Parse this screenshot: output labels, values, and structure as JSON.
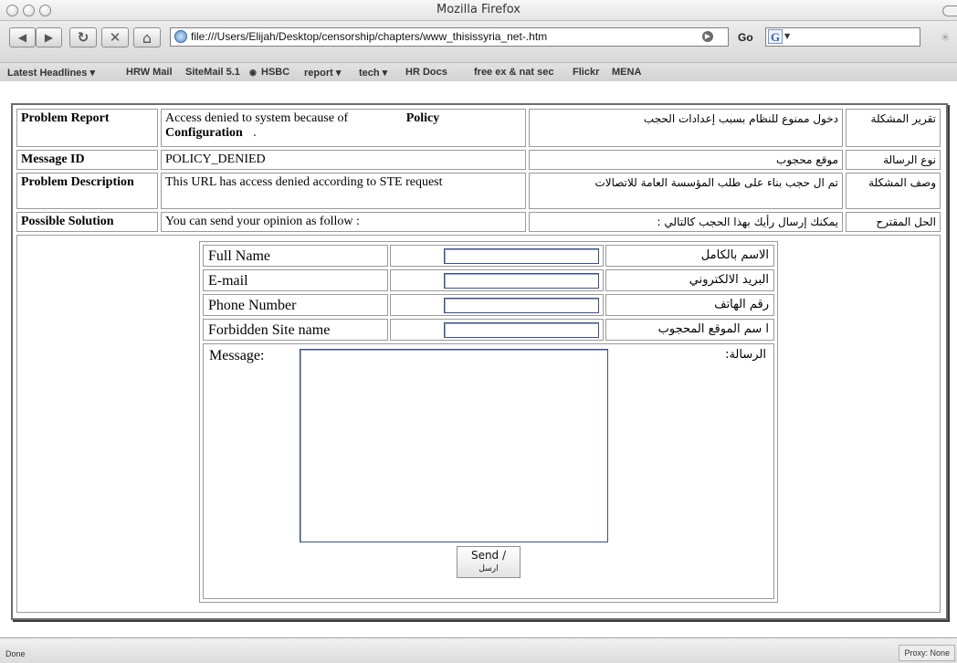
{
  "window": {
    "title": "Mozilla Firefox"
  },
  "nav": {
    "back_icon": "◀",
    "forward_icon": "▶",
    "reload_icon": "↻",
    "stop_icon": "✕",
    "home_icon": "⌂",
    "url": "file:///Users/Elijah/Desktop/censorship/chapters/www_thisissyria_net-.htm",
    "go_label": "Go",
    "search_engine_icon": "G"
  },
  "bookmarks": [
    "Latest Headlines ▾",
    "HRW Mail",
    "SiteMail 5.1",
    "HSBC",
    "report ▾",
    "tech ▾",
    "HR Docs",
    "free ex & nat sec",
    "Flickr",
    "MENA"
  ],
  "table": {
    "rows": [
      {
        "label": "Problem Report",
        "value": "Access denied to system because of",
        "value_bold": "Policy",
        "value_bold2": "Configuration",
        "value_end": ".",
        "ar_value": "دخول ممنوع للنظام بسبب إعدادات الحجب",
        "ar_label": "تقرير المشكلة"
      },
      {
        "label": "Message ID",
        "value": "POLICY_DENIED",
        "ar_value": "موقع محجوب",
        "ar_label": "نوع الرسالة"
      },
      {
        "label": "Problem Description",
        "value": "This URL has access denied according to STE request",
        "ar_value": "تم ال حجب بناء على طلب المؤسسة العامة للاتصالات",
        "ar_label": "وصف المشكلة"
      },
      {
        "label": "Possible Solution",
        "value": "You can send  your opinion as follow :",
        "ar_value": "يمكنك إرسال رأيك بهذا الحجب كالتالي :",
        "ar_label": "الحل المقترح"
      }
    ]
  },
  "form": {
    "fields": [
      {
        "label": "Full Name",
        "ar_label": "الاسم بالكامل",
        "value": ""
      },
      {
        "label": "E-mail",
        "ar_label": "البريد الالكتروني",
        "value": ""
      },
      {
        "label": "Phone Number",
        "ar_label": "رقم الهاتف",
        "value": ""
      },
      {
        "label": "Forbidden Site name",
        "ar_label": "ا سم الموقع المحجوب",
        "value": ""
      }
    ],
    "message_label": "Message:",
    "message_ar_label": "الرسالة:",
    "send_label": "Send /",
    "send_ar_label": "ارسل"
  },
  "status": {
    "text": "Done",
    "proxy": "Proxy: None"
  }
}
